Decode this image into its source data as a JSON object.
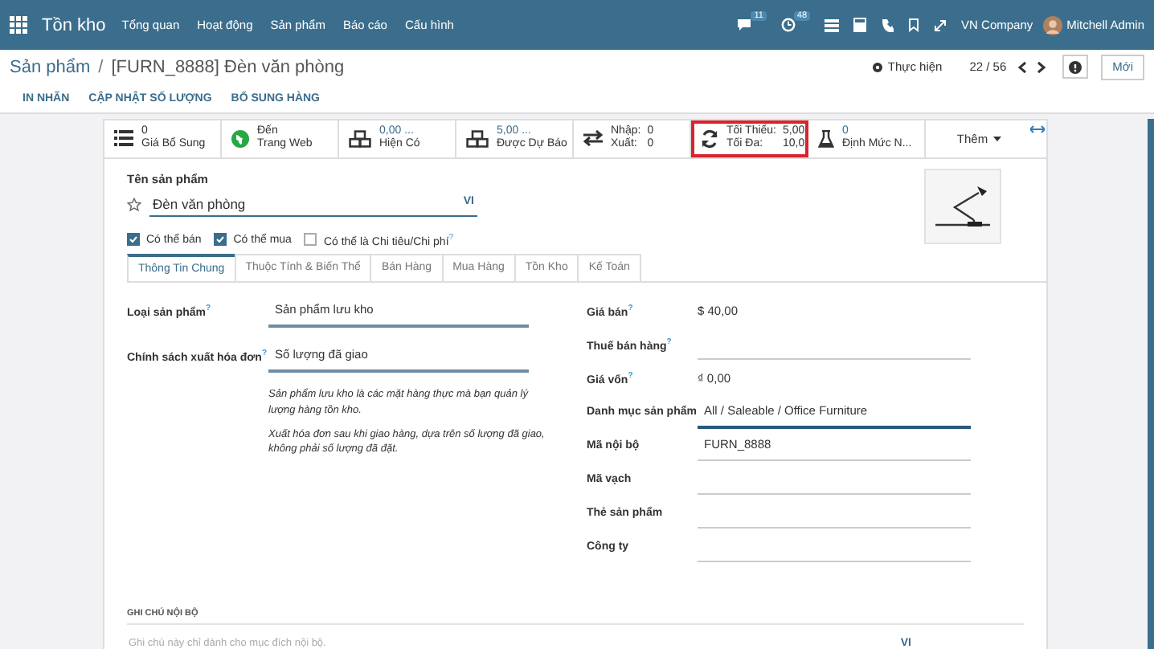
{
  "navbar": {
    "app": "Tồn kho",
    "menus": [
      "Tổng quan",
      "Hoạt động",
      "Sản phẩm",
      "Báo cáo",
      "Cấu hình"
    ],
    "messages_badge": "11",
    "activities_badge": "48",
    "company": "VN Company",
    "user": "Mitchell Admin"
  },
  "breadcrumb": {
    "parent": "Sản phẩm",
    "separator": "/",
    "current": "[FURN_8888] Đèn văn phòng"
  },
  "actions_menu": "Thực hiện",
  "pager": "22 / 56",
  "new_button": "Mới",
  "header_buttons": [
    "IN NHÃN",
    "CẬP NHẬT SỐ LƯỢNG",
    "BỔ SUNG HÀNG"
  ],
  "stat_buttons": [
    {
      "kind": "value",
      "value": "0",
      "label": "Giá Bổ Sung",
      "link": false,
      "highlighted": false
    },
    {
      "kind": "value",
      "value": "Đến",
      "label": "Trang Web",
      "link": false,
      "highlighted": false
    },
    {
      "kind": "value",
      "value": "0,00 ...",
      "label": "Hiện Có",
      "link": true,
      "highlighted": false
    },
    {
      "kind": "value",
      "value": "5,00 ...",
      "label": "Được Dự Báo",
      "link": true,
      "highlighted": false
    },
    {
      "kind": "pairs",
      "pairs": [
        {
          "label": "Nhập:",
          "value": "0"
        },
        {
          "label": "Xuất:",
          "value": "0"
        }
      ],
      "highlighted": false
    },
    {
      "kind": "pairs",
      "pairs": [
        {
          "label": "Tối Thiểu:",
          "value": "5,00"
        },
        {
          "label": "Tối Đa:",
          "value": "10,0"
        }
      ],
      "highlighted": true
    },
    {
      "kind": "value",
      "value": "0",
      "label": "Định Mức N...",
      "link": true,
      "highlighted": false
    },
    {
      "kind": "more",
      "label": "Thêm"
    }
  ],
  "form": {
    "name_label": "Tên sản phẩm",
    "name": "Đèn văn phòng",
    "favorite": false,
    "language": "VI",
    "options": [
      {
        "label": "Có thể bán",
        "checked": true
      },
      {
        "label": "Có thể mua",
        "checked": true
      },
      {
        "label": "Có thể là Chi tiêu/Chi phí",
        "checked": false,
        "help": "?"
      }
    ],
    "tabs": [
      {
        "label": "Thông Tin Chung",
        "selected": true
      },
      {
        "label": "Thuộc Tính & Biến Thể",
        "selected": false
      },
      {
        "label": "Bán Hàng",
        "selected": false
      },
      {
        "label": "Mua Hàng",
        "selected": false
      },
      {
        "label": "Tồn Kho",
        "selected": false
      },
      {
        "label": "Kế Toán",
        "selected": false
      }
    ],
    "left_fields": [
      {
        "label": "Loại sản phẩm",
        "help": "?",
        "value": "Sản phẩm lưu kho"
      },
      {
        "label": "Chính sách xuất hóa đơn",
        "help": "?",
        "value": "Số lượng đã giao"
      }
    ],
    "notes": [
      "Sản phẩm lưu kho là các mặt hàng thực mà bạn quản lý lượng hàng tồn kho.",
      "Xuất hóa đơn sau khi giao hàng, dựa trên số lượng đã giao, không phải số lượng đã đặt."
    ],
    "right_fields": [
      {
        "label": "Giá bán",
        "help": "?",
        "value": "$ 40,00",
        "kind": "plain"
      },
      {
        "label": "Thuế bán hàng",
        "help": "?",
        "kind": "input",
        "focused": false
      },
      {
        "label": "Giá vốn",
        "help": "?",
        "value": "₫ 0,00",
        "kind": "plain"
      },
      {
        "label": "Danh mục sản phẩm",
        "value": "All / Saleable / Office Furniture",
        "kind": "input",
        "focused": true
      },
      {
        "label": "Mã nội bộ",
        "value": "FURN_8888",
        "kind": "input",
        "focused": false
      },
      {
        "label": "Mã vạch",
        "kind": "input",
        "focused": false
      },
      {
        "label": "Thẻ sản phẩm",
        "kind": "input",
        "focused": false
      },
      {
        "label": "Công ty",
        "kind": "input",
        "focused": false
      }
    ],
    "internal_notes": {
      "title": "GHI CHÚ NỘI BỘ",
      "placeholder": "Ghi chú này chỉ dành cho mục đích nội bộ.",
      "language": "VI"
    }
  }
}
